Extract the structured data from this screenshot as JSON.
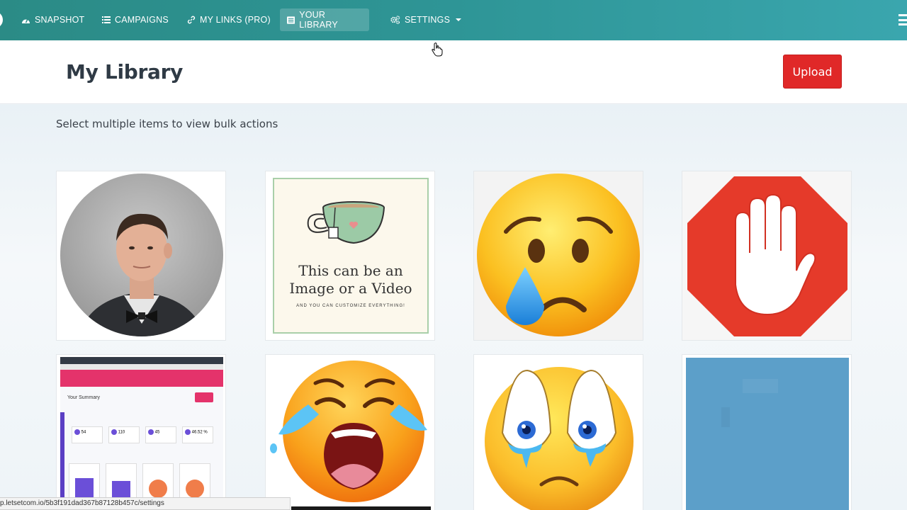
{
  "nav": {
    "items": [
      {
        "label": "SNAPSHOT",
        "icon": "dashboard-icon"
      },
      {
        "label": "CAMPAIGNS",
        "icon": "list-icon"
      },
      {
        "label": "MY LINKS (PRO)",
        "icon": "link-icon"
      },
      {
        "label": "YOUR LIBRARY",
        "icon": "library-icon"
      },
      {
        "label": "SETTINGS",
        "icon": "cogs-icon"
      }
    ],
    "active": "YOUR LIBRARY"
  },
  "header": {
    "title": "My Library",
    "upload_label": "Upload"
  },
  "main": {
    "hint": "Select multiple items to view bulk actions",
    "items": [
      {
        "kind": "photo",
        "alt": "Portrait photo of man in bow tie"
      },
      {
        "kind": "card",
        "line1": "This can be an",
        "line2": "Image or a Video",
        "line3": "AND YOU CAN CUSTOMIZE EVERYTHING!"
      },
      {
        "kind": "emoji",
        "alt": "Crying face emoji"
      },
      {
        "kind": "stop-sign",
        "alt": "Stop hand sign"
      },
      {
        "kind": "screenshot",
        "heading": "Your Summary",
        "stats": [
          "54",
          "110",
          "45",
          "46.52 %"
        ]
      },
      {
        "kind": "emoji",
        "alt": "Loudly crying face emoji"
      },
      {
        "kind": "emoji",
        "alt": "Sad teary face emoji"
      },
      {
        "kind": "video",
        "alt": "Blue video thumbnail"
      }
    ]
  },
  "status": {
    "url": "p.letsetcom.io/5b3f191dad367b87128b457c/settings"
  },
  "colors": {
    "nav_start": "#2b8b86",
    "nav_end": "#3aa6ae",
    "upload": "#e02828"
  }
}
